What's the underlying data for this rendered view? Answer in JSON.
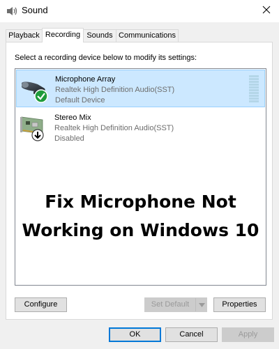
{
  "window": {
    "title": "Sound",
    "close_symbol": "✕"
  },
  "tabs": [
    {
      "label": "Playback",
      "active": false
    },
    {
      "label": "Recording",
      "active": true
    },
    {
      "label": "Sounds",
      "active": false
    },
    {
      "label": "Communications",
      "active": false
    }
  ],
  "recording": {
    "instructions": "Select a recording device below to modify its settings:",
    "devices": [
      {
        "name": "Microphone Array",
        "driver": "Realtek High Definition Audio(SST)",
        "status": "Default Device",
        "icon": "microphone-icon",
        "badge": "default-check-icon",
        "selected": true
      },
      {
        "name": "Stereo Mix",
        "driver": "Realtek High Definition Audio(SST)",
        "status": "Disabled",
        "icon": "sound-card-icon",
        "badge": "disabled-arrow-icon",
        "selected": false
      }
    ],
    "overlay_line1": "Fix Microphone Not",
    "overlay_line2": "Working on Windows 10",
    "configure_label": "Configure",
    "set_default_label": "Set Default",
    "properties_label": "Properties"
  },
  "footer": {
    "ok_label": "OK",
    "cancel_label": "Cancel",
    "apply_label": "Apply"
  },
  "colors": {
    "selection": "#cce8ff",
    "selection_border": "#99d1ff",
    "check_green": "#1e9b3a",
    "level_meter": "#b4d6e8"
  }
}
